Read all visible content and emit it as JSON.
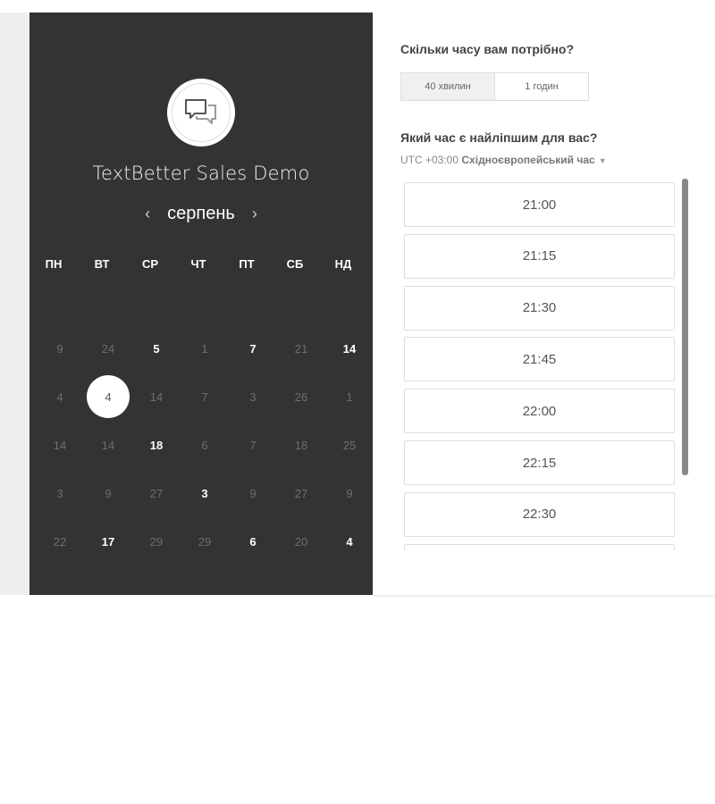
{
  "event": {
    "title": "TextBetter Sales Demo",
    "logo_icon": "chat-bubbles-icon"
  },
  "calendar": {
    "month": "серпень",
    "prev_icon": "‹",
    "next_icon": "›",
    "weekdays": [
      "ПН",
      "ВТ",
      "СР",
      "ЧТ",
      "ПТ",
      "СБ",
      "НД"
    ],
    "weeks": [
      [
        {
          "label": "9",
          "active": false
        },
        {
          "label": "24",
          "active": false
        },
        {
          "label": "5",
          "active": true
        },
        {
          "label": "1",
          "active": false
        },
        {
          "label": "7",
          "active": true
        },
        {
          "label": "21",
          "active": false
        },
        {
          "label": "14",
          "active": true
        }
      ],
      [
        {
          "label": "4",
          "active": false
        },
        {
          "label": "4",
          "active": true,
          "selected": true
        },
        {
          "label": "14",
          "active": false
        },
        {
          "label": "7",
          "active": false
        },
        {
          "label": "3",
          "active": false
        },
        {
          "label": "26",
          "active": false
        },
        {
          "label": "1",
          "active": false
        }
      ],
      [
        {
          "label": "14",
          "active": false
        },
        {
          "label": "14",
          "active": false
        },
        {
          "label": "18",
          "active": true
        },
        {
          "label": "6",
          "active": false
        },
        {
          "label": "7",
          "active": false
        },
        {
          "label": "18",
          "active": false
        },
        {
          "label": "25",
          "active": false
        }
      ],
      [
        {
          "label": "3",
          "active": false
        },
        {
          "label": "9",
          "active": false
        },
        {
          "label": "27",
          "active": false
        },
        {
          "label": "3",
          "active": true
        },
        {
          "label": "9",
          "active": false
        },
        {
          "label": "27",
          "active": false
        },
        {
          "label": "9",
          "active": false
        }
      ],
      [
        {
          "label": "22",
          "active": false
        },
        {
          "label": "17",
          "active": true
        },
        {
          "label": "29",
          "active": false
        },
        {
          "label": "29",
          "active": false
        },
        {
          "label": "6",
          "active": true
        },
        {
          "label": "20",
          "active": false
        },
        {
          "label": "4",
          "active": true
        }
      ]
    ]
  },
  "duration": {
    "question": "Скільки часу вам потрібно?",
    "options": [
      {
        "label": "40 хвилин",
        "selected": true
      },
      {
        "label": "1 годин",
        "selected": false
      }
    ]
  },
  "time": {
    "question": "Який час є найліпшим для вас?",
    "timezone_offset": "UTC +03:00",
    "timezone_name": "Східноєвропейський час",
    "slots": [
      "21:00",
      "21:15",
      "21:30",
      "21:45",
      "22:00",
      "22:15",
      "22:30",
      ""
    ]
  },
  "colors": {
    "left_panel": "#333333",
    "page_band": "#eeeeee",
    "slot_border": "#dddddd"
  }
}
